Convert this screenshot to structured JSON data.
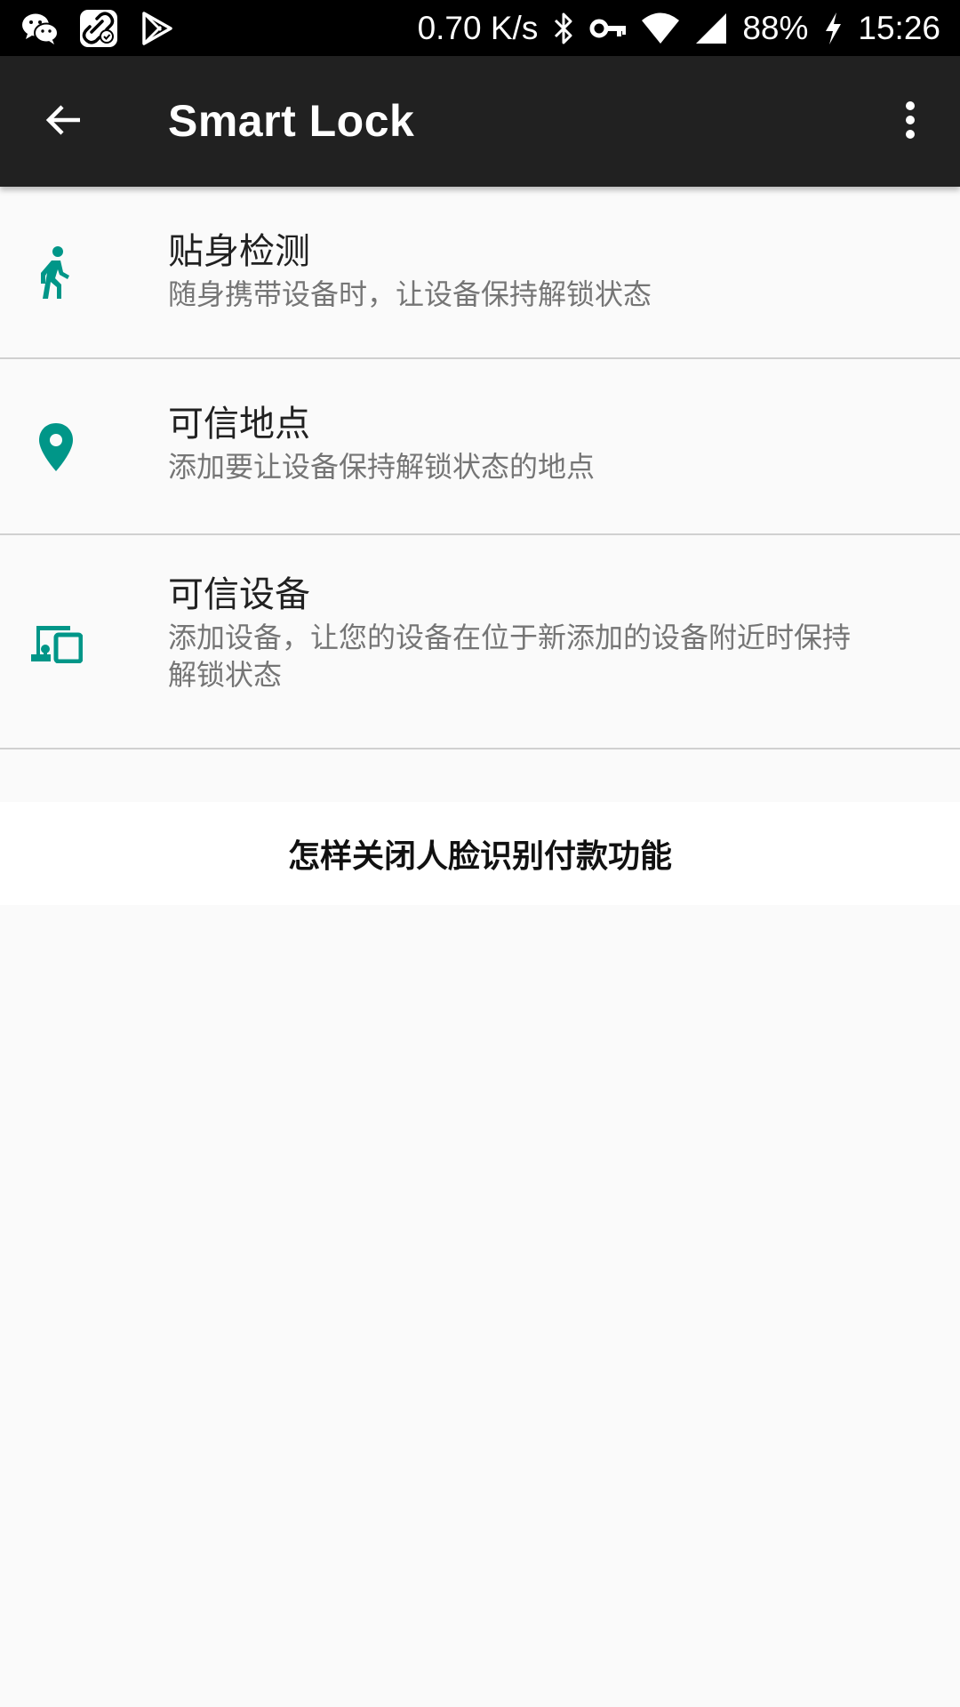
{
  "status_bar": {
    "icons_left": [
      "wechat-icon",
      "link-app-icon",
      "play-store-icon"
    ],
    "network_speed": "0.70 K/s",
    "icons_right": [
      "bluetooth-icon",
      "key-icon",
      "wifi-icon",
      "cell-signal-icon"
    ],
    "battery": "88%",
    "charging_icon": "bolt-icon",
    "time": "15:26"
  },
  "app_bar": {
    "back_icon": "arrow-back-icon",
    "title": "Smart Lock",
    "more_icon": "more-vert-icon"
  },
  "accent_color": "#009688",
  "items": [
    {
      "icon": "walk-icon",
      "title": "贴身检测",
      "summary": "随身携带设备时，让设备保持解锁状态"
    },
    {
      "icon": "location-pin-icon",
      "title": "可信地点",
      "summary": "添加要让设备保持解锁状态的地点"
    },
    {
      "icon": "devices-icon",
      "title": "可信设备",
      "summary": "添加设备，让您的设备在位于新添加的设备附近时保持解锁状态"
    }
  ],
  "banner": {
    "text": "怎样关闭人脸识别付款功能"
  }
}
